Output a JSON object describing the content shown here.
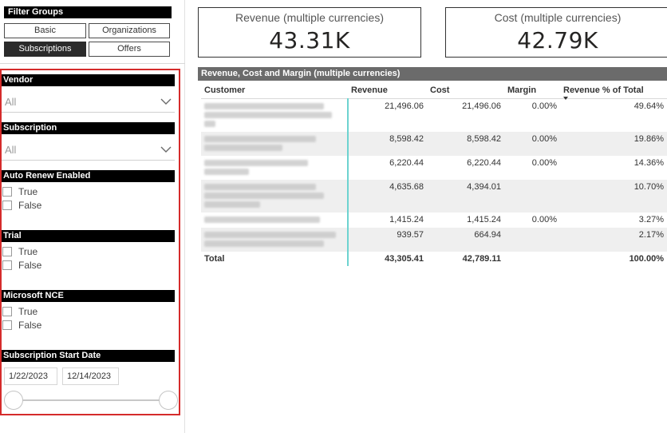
{
  "filter_groups": {
    "title": "Filter Groups",
    "buttons": [
      {
        "label": "Basic",
        "active": false
      },
      {
        "label": "Organizations",
        "active": false
      },
      {
        "label": "Subscriptions",
        "active": true
      },
      {
        "label": "Offers",
        "active": false
      }
    ]
  },
  "filters": {
    "vendor": {
      "label": "Vendor",
      "value": "All"
    },
    "subscription": {
      "label": "Subscription",
      "value": "All"
    },
    "auto_renew": {
      "label": "Auto Renew Enabled",
      "options": [
        "True",
        "False"
      ]
    },
    "trial": {
      "label": "Trial",
      "options": [
        "True",
        "False"
      ]
    },
    "microsoft_nce": {
      "label": "Microsoft NCE",
      "options": [
        "True",
        "False"
      ]
    },
    "start_date": {
      "label": "Subscription Start Date",
      "from": "1/22/2023",
      "to": "12/14/2023"
    }
  },
  "cards": {
    "revenue": {
      "title": "Revenue (multiple currencies)",
      "value": "43.31K"
    },
    "cost": {
      "title": "Cost (multiple currencies)",
      "value": "42.79K"
    }
  },
  "table": {
    "title": "Revenue, Cost and Margin (multiple currencies)",
    "columns": [
      "Customer",
      "Revenue",
      "Cost",
      "Margin",
      "Revenue % of Total"
    ],
    "rows": [
      {
        "revenue": "21,496.06",
        "cost": "21,496.06",
        "margin": "0.00%",
        "pct": "49.64%"
      },
      {
        "revenue": "8,598.42",
        "cost": "8,598.42",
        "margin": "0.00%",
        "pct": "19.86%"
      },
      {
        "revenue": "6,220.44",
        "cost": "6,220.44",
        "margin": "0.00%",
        "pct": "14.36%"
      },
      {
        "revenue": "4,635.68",
        "cost": "4,394.01",
        "margin": "",
        "pct": "10.70%"
      },
      {
        "revenue": "1,415.24",
        "cost": "1,415.24",
        "margin": "0.00%",
        "pct": "3.27%"
      },
      {
        "revenue": "939.57",
        "cost": "664.94",
        "margin": "",
        "pct": "2.17%"
      }
    ],
    "total": {
      "label": "Total",
      "revenue": "43,305.41",
      "cost": "42,789.11",
      "margin": "",
      "pct": "100.00%"
    }
  },
  "colors": {
    "highlight_border": "#d52b2b",
    "column_separator": "#6dd3d0",
    "header_bg": "#000000",
    "table_title_bg": "#6b6b6b"
  }
}
